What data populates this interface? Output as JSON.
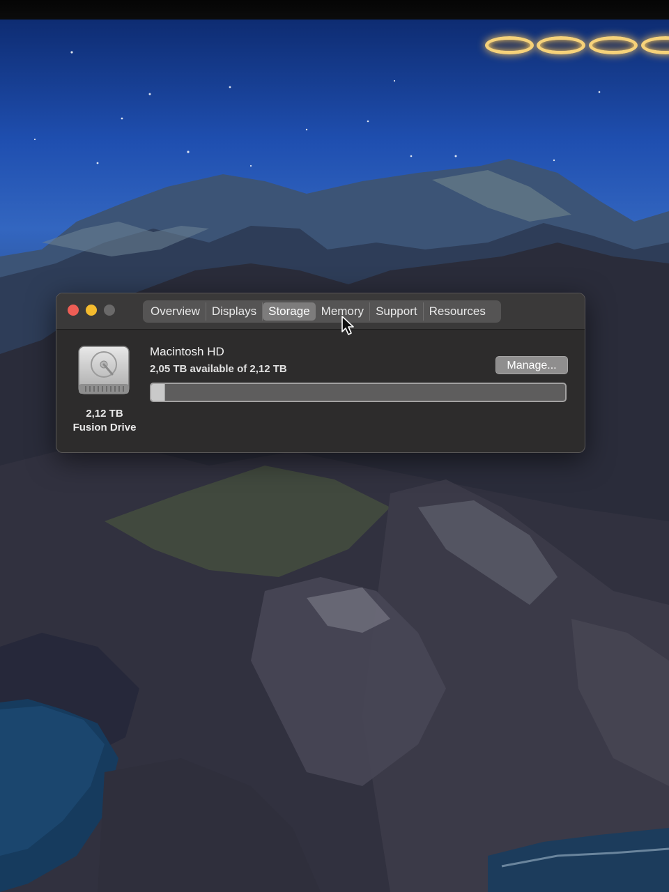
{
  "window": {
    "tabs": [
      {
        "label": "Overview",
        "active": false
      },
      {
        "label": "Displays",
        "active": false
      },
      {
        "label": "Storage",
        "active": true
      },
      {
        "label": "Memory",
        "active": false
      },
      {
        "label": "Support",
        "active": false
      },
      {
        "label": "Resources",
        "active": false
      }
    ],
    "traffic_light_colors": {
      "close": "#ee5e55",
      "minimize": "#f4bb2e",
      "zoom": "#6a6969"
    }
  },
  "storage": {
    "disk_icon": "hard-drive-icon",
    "disk_size": "2,12 TB",
    "disk_type": "Fusion Drive",
    "volume_name": "Macintosh HD",
    "available_text": "2,05 TB available of 2,12 TB",
    "used_fraction": 0.033,
    "manage_label": "Manage..."
  },
  "cursor_icon": "arrow-cursor-icon"
}
